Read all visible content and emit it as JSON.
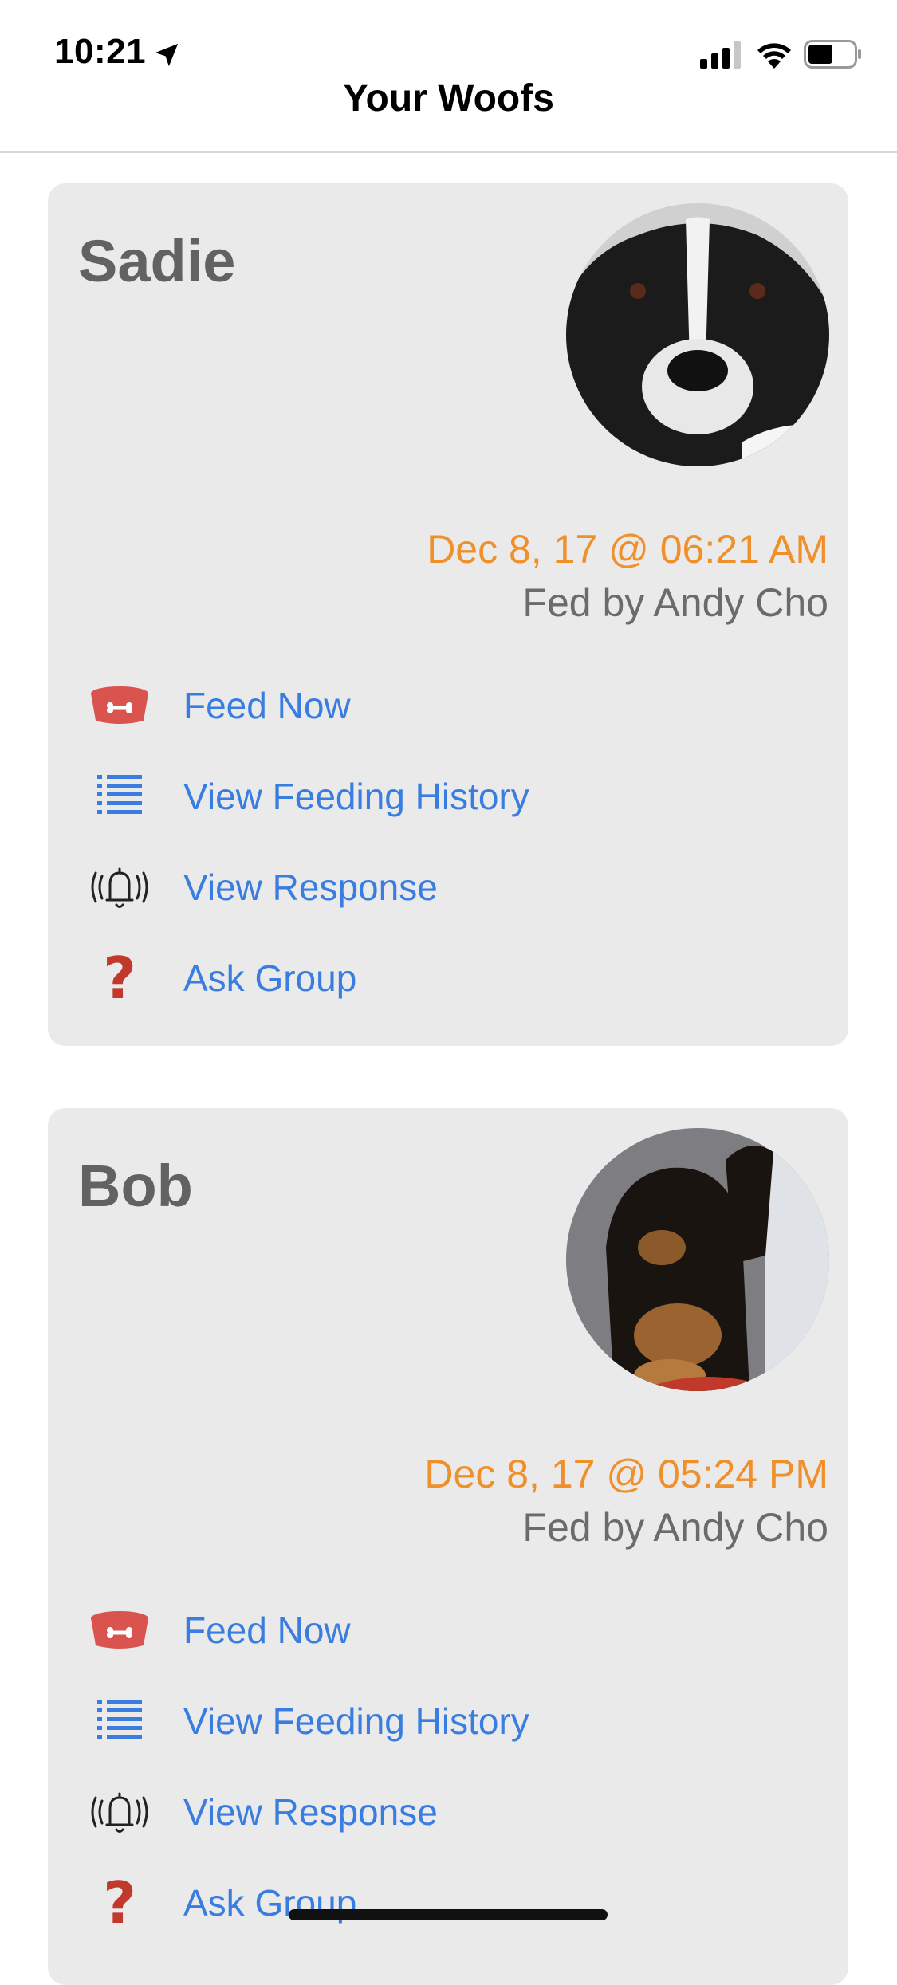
{
  "status_bar": {
    "time": "10:21"
  },
  "navbar": {
    "title": "Your Woofs"
  },
  "cards": [
    {
      "name": "Sadie",
      "last_fed": "Dec 8, 17 @ 06:21 AM",
      "fed_by": "Fed by Andy Cho",
      "actions": [
        {
          "label": "Feed Now",
          "icon": "dog-bowl-icon"
        },
        {
          "label": "View Feeding History",
          "icon": "list-icon"
        },
        {
          "label": "View Response",
          "icon": "bell-ringing-icon"
        },
        {
          "label": "Ask Group",
          "icon": "question-mark-icon"
        }
      ]
    },
    {
      "name": "Bob",
      "last_fed": "Dec 8, 17 @ 05:24 PM",
      "fed_by": "Fed by Andy Cho",
      "actions": [
        {
          "label": "Feed Now",
          "icon": "dog-bowl-icon"
        },
        {
          "label": "View Feeding History",
          "icon": "list-icon"
        },
        {
          "label": "View Response",
          "icon": "bell-ringing-icon"
        },
        {
          "label": "Ask Group",
          "icon": "question-mark-icon"
        }
      ]
    }
  ],
  "colors": {
    "accent_link": "#3a7de0",
    "timestamp": "#f0902b",
    "card_bg": "#eaeaea",
    "bowl": "#d9534f"
  }
}
